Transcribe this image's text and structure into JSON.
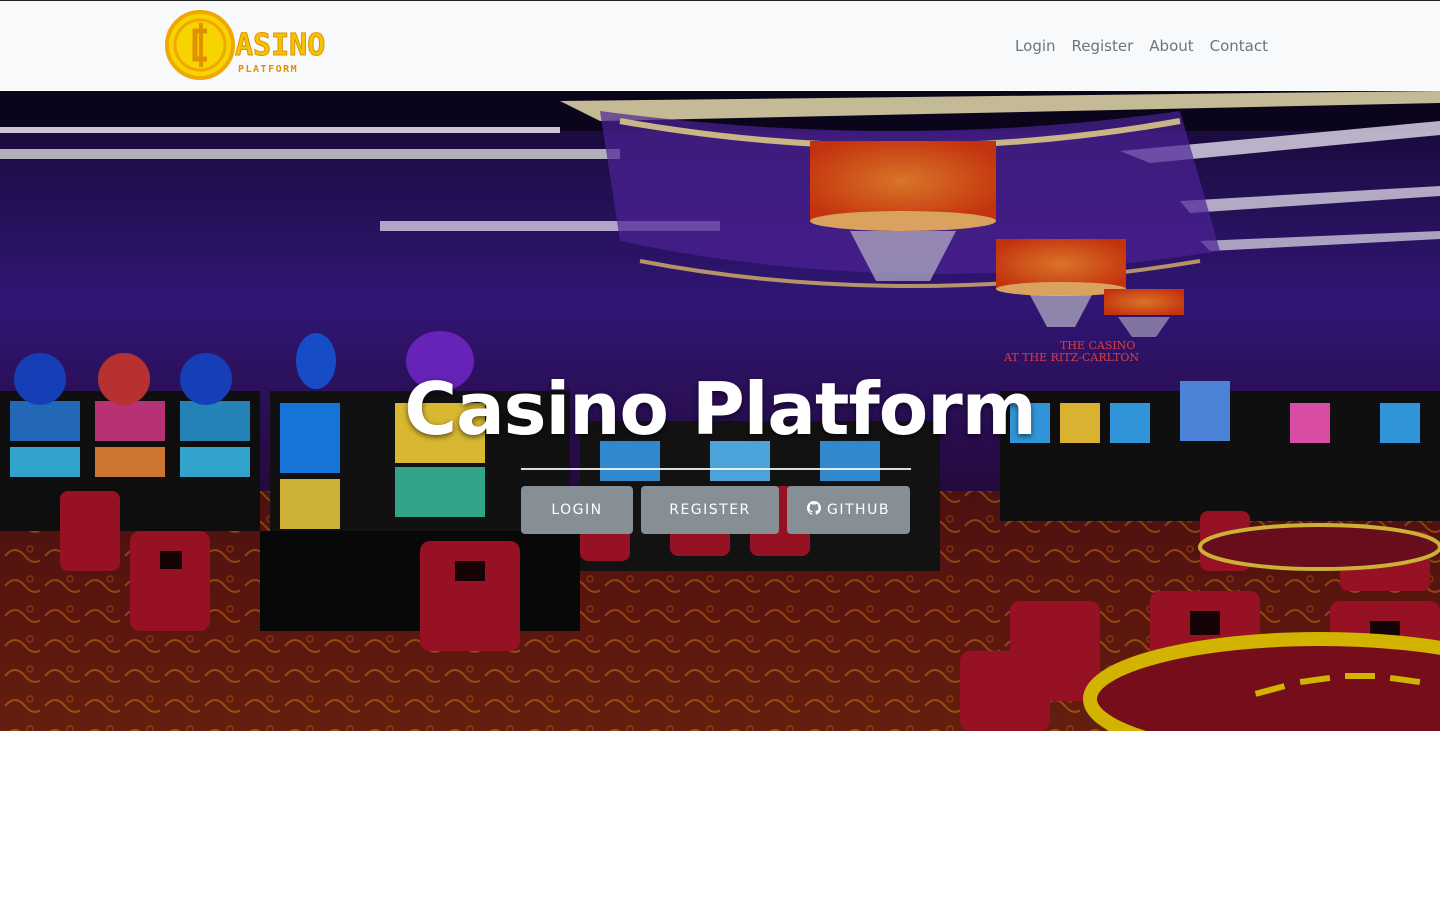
{
  "navbar": {
    "logo": {
      "main_text": "ASINO",
      "sub_text": "PLATFORM",
      "icon": "casino-coin-icon",
      "color": "#f5c400"
    },
    "links": [
      {
        "label": "Login"
      },
      {
        "label": "Register"
      },
      {
        "label": "About"
      },
      {
        "label": "Contact"
      }
    ]
  },
  "hero": {
    "title": "Casino Platform",
    "background": "casino-floor-photo",
    "buttons": {
      "login": "LOGIN",
      "register": "REGISTER",
      "github": "GITHUB",
      "github_icon": "github-icon"
    },
    "button_color": "#868e96"
  }
}
